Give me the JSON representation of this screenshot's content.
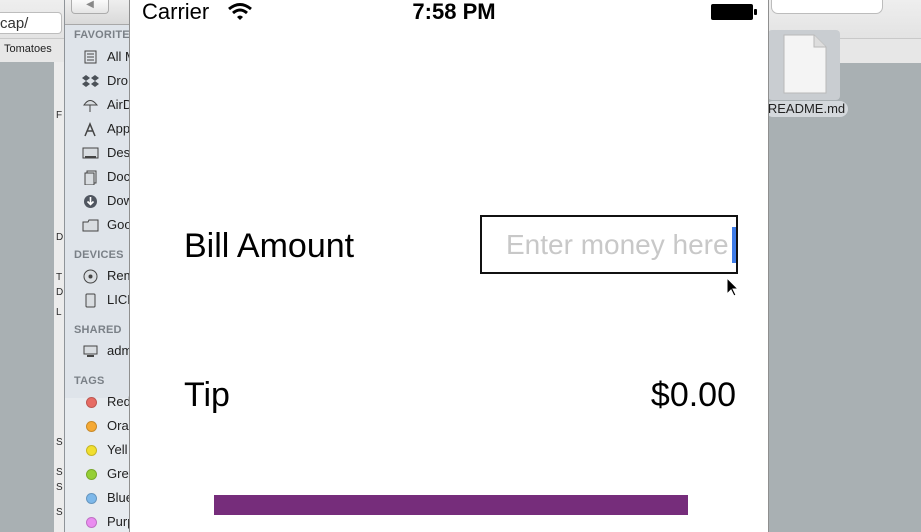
{
  "browser": {
    "url_fragment": "cap/",
    "bookmark_1": "Tomatoes"
  },
  "finder": {
    "favorites_header": "FAVORITES",
    "devices_header": "DEVICES",
    "shared_header": "SHARED",
    "tags_header": "TAGS",
    "favorites": [
      {
        "label": "All M",
        "icon": "all-my-files-icon"
      },
      {
        "label": "Dro",
        "icon": "dropbox-icon"
      },
      {
        "label": "AirD",
        "icon": "airdrop-icon"
      },
      {
        "label": "App",
        "icon": "applications-icon"
      },
      {
        "label": "Des",
        "icon": "desktop-icon"
      },
      {
        "label": "Doc",
        "icon": "documents-icon"
      },
      {
        "label": "Dow",
        "icon": "downloads-icon"
      },
      {
        "label": "Goo",
        "icon": "folder-icon"
      }
    ],
    "devices": [
      {
        "label": "Rem",
        "icon": "remote-disc-icon"
      },
      {
        "label": "LICE",
        "icon": "drive-icon"
      }
    ],
    "shared": [
      {
        "label": "adm",
        "icon": "computer-icon"
      }
    ],
    "tags": [
      {
        "label": "Red",
        "color": "#e76b63"
      },
      {
        "label": "Ora",
        "color": "#f5a934"
      },
      {
        "label": "Yell",
        "color": "#f1df2f"
      },
      {
        "label": "Gre",
        "color": "#95cf35"
      },
      {
        "label": "Blue",
        "color": "#7db8ea"
      },
      {
        "label": "Purp",
        "color": "#ea8cf0"
      }
    ]
  },
  "desktop": {
    "file_name": "README.md"
  },
  "simulator": {
    "status": {
      "carrier": "Carrier",
      "time": "7:58 PM"
    },
    "bill": {
      "label": "Bill Amount",
      "placeholder": "Enter money here"
    },
    "tip": {
      "label": "Tip",
      "value": "$0.00"
    },
    "accent_color": "#762d7b",
    "caret_color": "#3f7ce7"
  }
}
